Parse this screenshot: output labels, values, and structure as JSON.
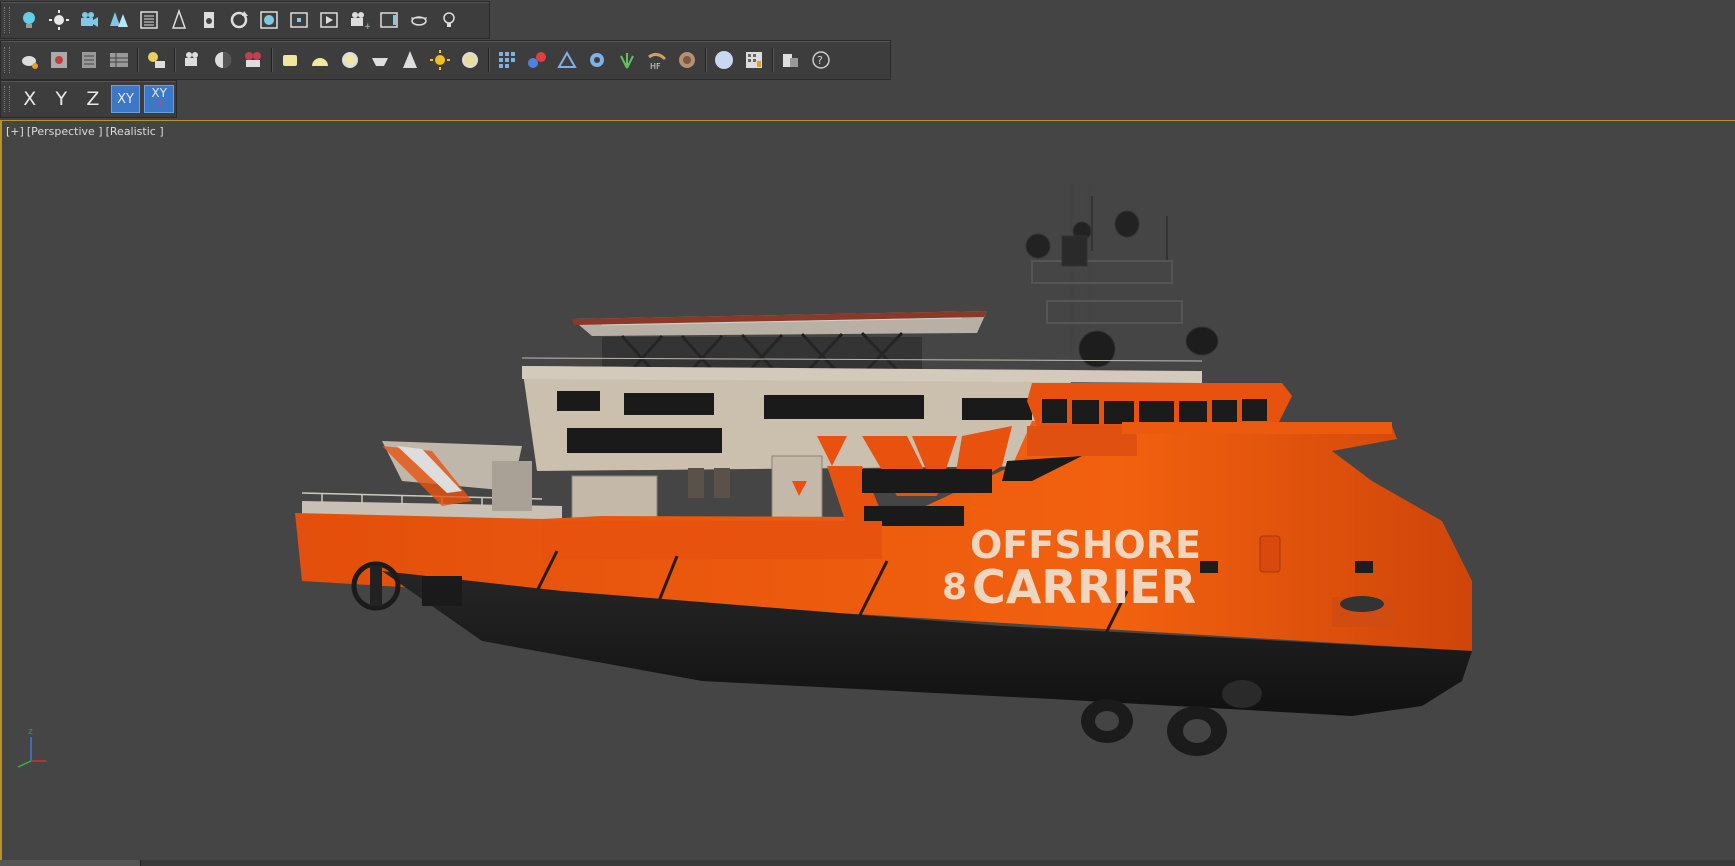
{
  "toolbars": {
    "row1": {
      "icons": [
        "light-bulb-icon",
        "sun-light-icon",
        "camera-group-icon",
        "tree-icon",
        "list-icon",
        "cone-icon",
        "anchor-icon",
        "rotate-icon",
        "render-frame-icon",
        "move-icon",
        "play-frame-icon",
        "camera-plus-icon",
        "frame-icon",
        "teapot-icon",
        "light-bulb-outline-icon"
      ]
    },
    "row2": {
      "icons": [
        "teapot-render-icon",
        "render-window-icon",
        "list-panel-icon",
        "table-icon",
        "light-list-icon",
        "camera-icon",
        "sphere-half-icon",
        "film-camera-icon",
        "box-icon",
        "dome-icon",
        "disc-icon",
        "bowl-icon",
        "cone-light-icon",
        "sun-icon",
        "sphere-yellow-icon",
        "grid-icon",
        "molecule-icon",
        "envelope-icon",
        "gear-icon",
        "grass-icon",
        "hair-fur-icon",
        "shell-icon",
        "sphere-white-icon",
        "material-grid-icon",
        "copy-icon",
        "help-icon"
      ]
    },
    "row3": {
      "axes": [
        {
          "label": "X",
          "active": false
        },
        {
          "label": "Y",
          "active": false
        },
        {
          "label": "Z",
          "active": false
        },
        {
          "label": "XY",
          "active": true
        },
        {
          "label": "XY",
          "active": true
        }
      ]
    }
  },
  "viewport": {
    "label_plus": "[+]",
    "label_view": "[Perspective ]",
    "label_shading": "[Realistic ]",
    "ship": {
      "name_line1": "OFFSHORE",
      "name_line2": "CARRIER",
      "name_number": "8"
    },
    "gizmo_label": "z"
  },
  "colors": {
    "hull_orange": "#e8520e",
    "hull_black": "#1d1d1d",
    "superstructure": "#cbbfae",
    "viewport_border": "#b8922a",
    "active_axis": "#3c78c8"
  }
}
